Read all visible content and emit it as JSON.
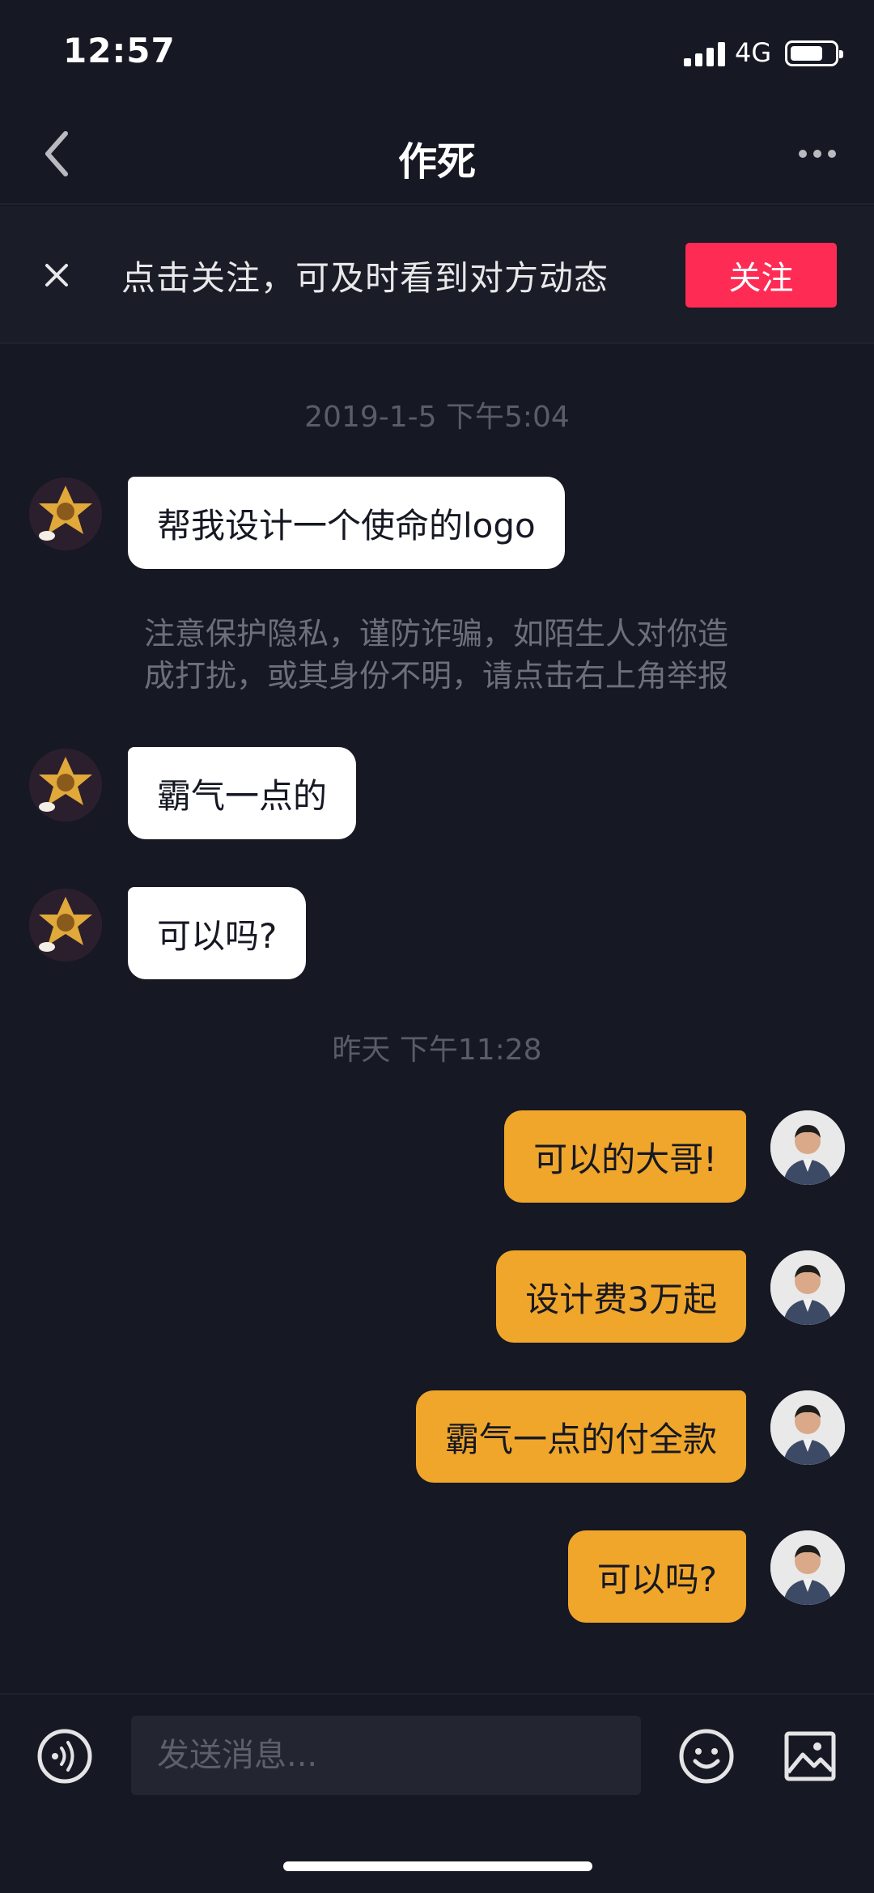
{
  "status_bar": {
    "time": "12:57",
    "network": "4G",
    "battery_level": 0.75
  },
  "header": {
    "title": "作死",
    "back_icon": "chevron-left-icon",
    "more_icon": "more-dots-icon"
  },
  "follow_banner": {
    "text": "点击关注，可及时看到对方动态",
    "button_label": "关注",
    "button_color": "#fe2c55"
  },
  "conversation": {
    "timestamp_1": "2019-1-5 下午5:04",
    "incoming_1": "帮我设计一个使命的logo",
    "privacy_notice_line1": "注意保护隐私，谨防诈骗，如陌生人对你造",
    "privacy_notice_line2": "成打扰，或其身份不明，请点击右上角举报",
    "incoming_2": "霸气一点的",
    "incoming_3": "可以吗?",
    "timestamp_2": "昨天 下午11:28",
    "outgoing_1": "可以的大哥!",
    "outgoing_2": "设计费3万起",
    "outgoing_3": "霸气一点的付全款",
    "outgoing_4": "可以吗?"
  },
  "composer": {
    "placeholder": "发送消息...",
    "voice_icon": "voice-icon",
    "emoji_icon": "emoji-icon",
    "image_icon": "image-icon"
  },
  "colors": {
    "background": "#161823",
    "outgoing_bubble": "#f0a62a",
    "incoming_bubble": "#ffffff"
  }
}
